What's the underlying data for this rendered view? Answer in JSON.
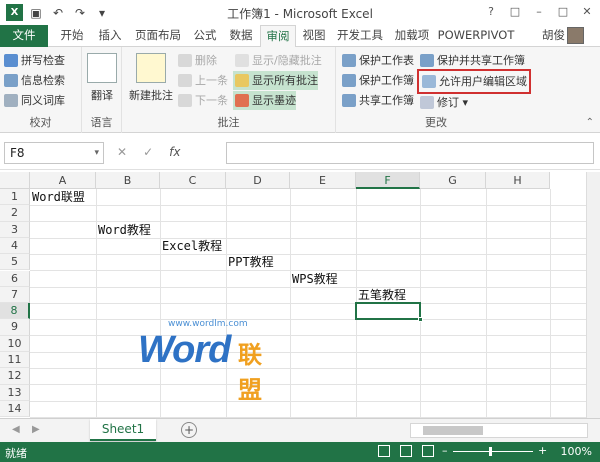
{
  "app": {
    "title": "工作簿1 - Microsoft Excel",
    "user": "胡俊"
  },
  "tabs": [
    "文件",
    "开始",
    "插入",
    "页面布局",
    "公式",
    "数据",
    "审阅",
    "视图",
    "开发工具",
    "加载项",
    "POWERPIVOT"
  ],
  "ribbon": {
    "proofing": {
      "label": "校对",
      "items": [
        "拼写检查",
        "信息检索",
        "同义词库"
      ]
    },
    "language": {
      "label": "语言",
      "translate": "翻译"
    },
    "comments": {
      "label": "批注",
      "new_comment": "新建批注",
      "delete": "删除",
      "previous": "上一条",
      "next": "下一条",
      "show_hide": "显示/隐藏批注",
      "show_all": "显示所有批注",
      "show_ink": "显示墨迹"
    },
    "changes": {
      "label": "更改",
      "protect_sheet": "保护工作表",
      "protect_workbook": "保护工作簿",
      "share_workbook": "共享工作簿",
      "protect_share": "保护并共享工作簿",
      "allow_edit_ranges": "允许用户编辑区域",
      "track_changes": "修订"
    }
  },
  "formula_bar": {
    "name_box": "F8",
    "fx": "fx",
    "content": ""
  },
  "columns": [
    "A",
    "B",
    "C",
    "D",
    "E",
    "F",
    "G",
    "H"
  ],
  "rows": [
    "1",
    "2",
    "3",
    "4",
    "5",
    "6",
    "7",
    "8",
    "9",
    "10",
    "11",
    "12",
    "13",
    "14"
  ],
  "cells": {
    "A1": "Word联盟",
    "B3": "Word教程",
    "C4": "Excel教程",
    "D5": "PPT教程",
    "E6": "WPS教程",
    "F7": "五笔教程"
  },
  "watermark": {
    "url": "www.wordlm.com",
    "word": "Word",
    "cn": "联盟"
  },
  "sheet_tab": "Sheet1",
  "status": {
    "ready": "就绪",
    "zoom": "100%"
  },
  "colors": {
    "accent": "#217346",
    "highlight": "#c6e3cf",
    "callout": "#d03030"
  }
}
